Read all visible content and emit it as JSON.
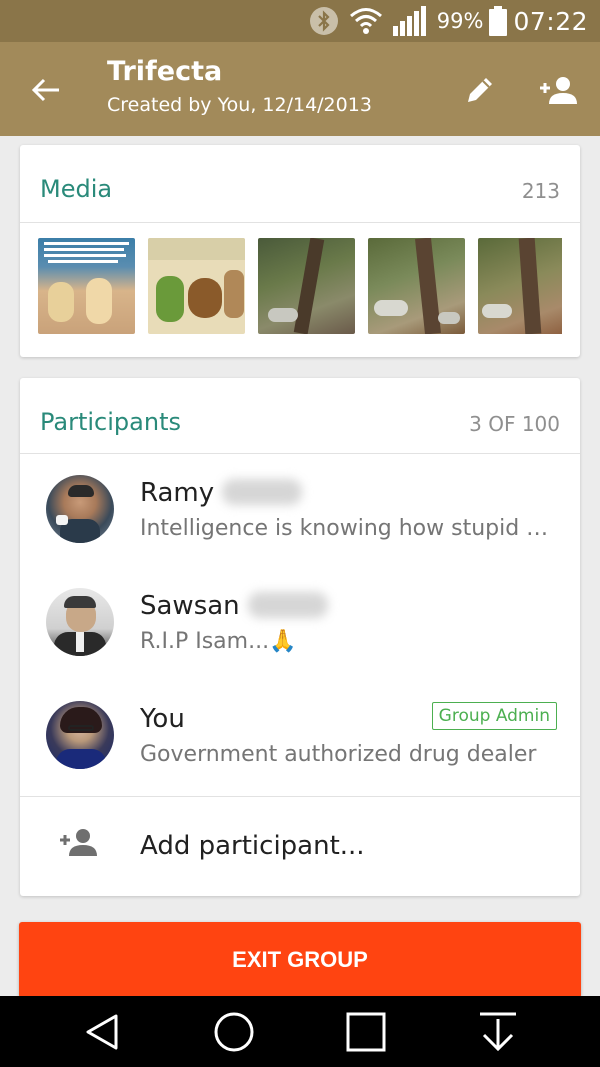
{
  "status_bar": {
    "bluetooth_icon": "bluetooth-icon",
    "wifi_icon": "wifi-icon",
    "signal_icon": "signal-icon",
    "battery_percent": "99%",
    "battery_icon": "battery-icon",
    "time": "07:22"
  },
  "toolbar": {
    "back_icon": "back-arrow-icon",
    "title": "Trifecta",
    "subtitle": "Created by You, 12/14/2013",
    "edit_icon": "pencil-icon",
    "add_participant_icon": "add-person-icon"
  },
  "media": {
    "title": "Media",
    "count": "213",
    "thumbnails": [
      "meme-image",
      "cartoon-image",
      "forest-photo",
      "forest-photo",
      "forest-photo"
    ]
  },
  "participants": {
    "title": "Participants",
    "count": "3 OF 100",
    "items": [
      {
        "name": "Ramy",
        "status": "Intelligence is knowing how stupid you are",
        "admin": ""
      },
      {
        "name": "Sawsan",
        "status": "R.I.P Isam...🙏",
        "admin": ""
      },
      {
        "name": "You",
        "status": "Government authorized drug dealer",
        "admin": "Group Admin"
      }
    ],
    "add_label": "Add participant..."
  },
  "exit_button": "EXIT GROUP",
  "nav_bar": {
    "back": "nav-back-icon",
    "home": "nav-home-icon",
    "recents": "nav-recents-icon",
    "notifications": "nav-notifications-icon"
  },
  "colors": {
    "status_bar": "#8a7549",
    "toolbar": "#a28a5a",
    "accent_teal": "#2a8a7a",
    "exit_orange": "#ff4411",
    "admin_green": "#4caf50"
  }
}
